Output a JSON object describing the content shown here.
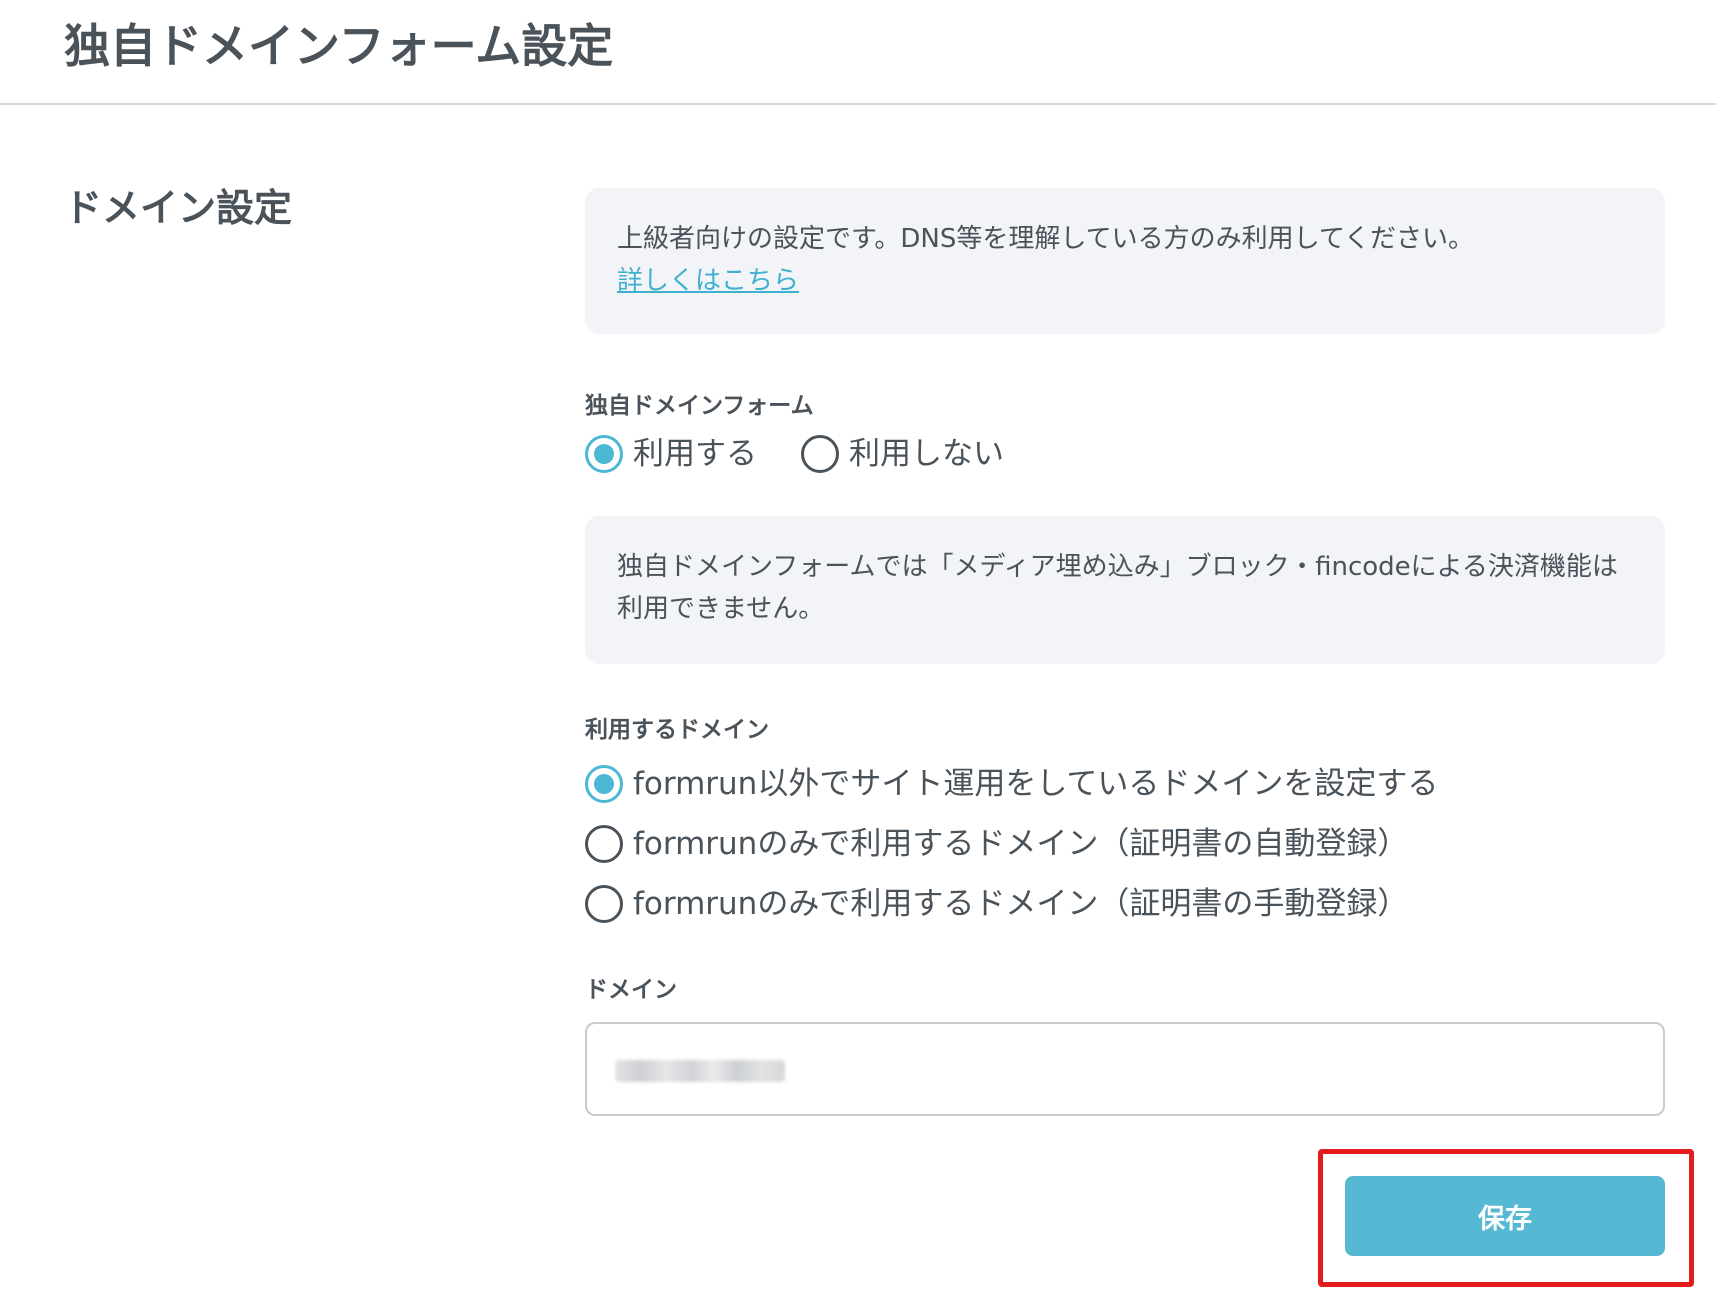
{
  "page": {
    "title": "独自ドメインフォーム設定"
  },
  "section": {
    "title": "ドメイン設定"
  },
  "advanced_notice": {
    "text": "上級者向けの設定です。DNS等を理解している方のみ利用してください。",
    "link_label": "詳しくはこちら"
  },
  "custom_domain_form": {
    "label": "独自ドメインフォーム",
    "options": [
      {
        "label": "利用する",
        "selected": true
      },
      {
        "label": "利用しない",
        "selected": false
      }
    ]
  },
  "restriction_notice": {
    "text": "独自ドメインフォームでは「メディア埋め込み」ブロック・fincodeによる決済機能は利用できません。"
  },
  "domain_usage": {
    "label": "利用するドメイン",
    "options": [
      {
        "label": "formrun以外でサイト運用をしているドメインを設定する",
        "selected": true
      },
      {
        "label": "formrunのみで利用するドメイン（証明書の自動登録）",
        "selected": false
      },
      {
        "label": "formrunのみで利用するドメイン（証明書の手動登録）",
        "selected": false
      }
    ]
  },
  "domain_field": {
    "label": "ドメイン"
  },
  "actions": {
    "save_label": "保存",
    "highlight_color": "#e21b1b"
  },
  "colors": {
    "accent": "#56b8d3",
    "text": "#4a525a",
    "notice_bg": "#f3f4f8",
    "link": "#3fb1cf"
  }
}
